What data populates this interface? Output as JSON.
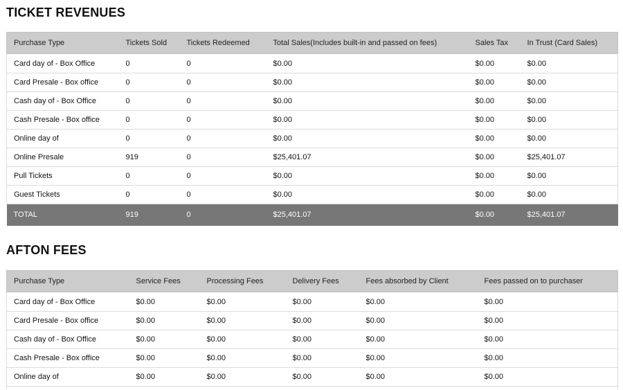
{
  "revenues": {
    "title": "TICKET REVENUES",
    "headers": [
      "Purchase Type",
      "Tickets Sold",
      "Tickets Redeemed",
      "Total Sales(Includes built-in and passed on fees)",
      "Sales Tax",
      "In Trust (Card Sales)"
    ],
    "rows": [
      [
        "Card day of - Box Office",
        "0",
        "0",
        "$0.00",
        "$0.00",
        "$0.00"
      ],
      [
        "Card Presale - Box office",
        "0",
        "0",
        "$0.00",
        "$0.00",
        "$0.00"
      ],
      [
        "Cash day of - Box Office",
        "0",
        "0",
        "$0.00",
        "$0.00",
        "$0.00"
      ],
      [
        "Cash Presale - Box office",
        "0",
        "0",
        "$0.00",
        "$0.00",
        "$0.00"
      ],
      [
        "Online day of",
        "0",
        "0",
        "$0.00",
        "$0.00",
        "$0.00"
      ],
      [
        "Online Presale",
        "919",
        "0",
        "$25,401.07",
        "$0.00",
        "$25,401.07"
      ],
      [
        "Pull Tickets",
        "0",
        "0",
        "$0.00",
        "$0.00",
        "$0.00"
      ],
      [
        "Guest Tickets",
        "0",
        "0",
        "$0.00",
        "$0.00",
        "$0.00"
      ]
    ],
    "total": [
      "TOTAL",
      "919",
      "0",
      "$25,401.07",
      "$0.00",
      "$25,401.07"
    ]
  },
  "fees": {
    "title": "AFTON FEES",
    "headers": [
      "Purchase Type",
      "Service Fees",
      "Processing Fees",
      "Delivery Fees",
      "Fees absorbed by Client",
      "Fees passed on to purchaser"
    ],
    "rows": [
      [
        "Card day of - Box Office",
        "$0.00",
        "$0.00",
        "$0.00",
        "$0.00",
        "$0.00"
      ],
      [
        "Card Presale - Box office",
        "$0.00",
        "$0.00",
        "$0.00",
        "$0.00",
        "$0.00"
      ],
      [
        "Cash day of - Box Office",
        "$0.00",
        "$0.00",
        "$0.00",
        "$0.00",
        "$0.00"
      ],
      [
        "Cash Presale - Box office",
        "$0.00",
        "$0.00",
        "$0.00",
        "$0.00",
        "$0.00"
      ],
      [
        "Online day of",
        "$0.00",
        "$0.00",
        "$0.00",
        "$0.00",
        "$0.00"
      ],
      [
        "",
        "",
        "",
        "",
        "",
        ""
      ]
    ]
  },
  "colors": {
    "header_bg": "#cccccc",
    "total_bg": "#777777",
    "total_text": "#ffffff"
  }
}
